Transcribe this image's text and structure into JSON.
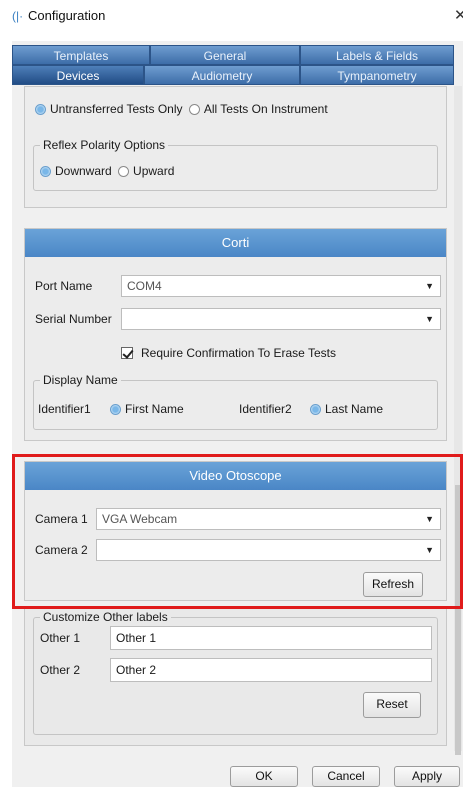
{
  "window": {
    "title": "Configuration",
    "close_glyph": "✕"
  },
  "tabs_row1": [
    {
      "label": "Templates"
    },
    {
      "label": "General"
    },
    {
      "label": "Labels & Fields"
    }
  ],
  "tabs_row2": [
    {
      "label": "Devices",
      "active": true
    },
    {
      "label": "Audiometry"
    },
    {
      "label": "Tympanometry"
    }
  ],
  "transfer": {
    "options": [
      {
        "label": "Untransferred Tests Only",
        "checked": true
      },
      {
        "label": "All Tests On Instrument",
        "checked": false
      }
    ]
  },
  "reflex": {
    "title": "Reflex Polarity Options",
    "options": [
      {
        "label": "Downward",
        "checked": true
      },
      {
        "label": "Upward",
        "checked": false
      }
    ]
  },
  "corti": {
    "header": "Corti",
    "port_label": "Port Name",
    "port_value": "COM4",
    "serial_label": "Serial Number",
    "serial_value": "",
    "confirm_label": "Require Confirmation To Erase Tests",
    "display_name_title": "Display Name",
    "identifier1_label": "Identifier1",
    "identifier1_value": "First Name",
    "identifier2_label": "Identifier2",
    "identifier2_value": "Last Name"
  },
  "otoscope": {
    "header": "Video Otoscope",
    "camera1_label": "Camera 1",
    "camera1_value": "VGA Webcam",
    "camera2_label": "Camera 2",
    "camera2_value": "",
    "refresh_label": "Refresh"
  },
  "other_labels": {
    "title": "Customize Other labels",
    "other1_label": "Other 1",
    "other1_value": "Other 1",
    "other2_label": "Other 2",
    "other2_value": "Other 2",
    "reset_label": "Reset"
  },
  "footer": {
    "ok": "OK",
    "cancel": "Cancel",
    "apply": "Apply"
  },
  "colors": {
    "highlight": "#e01b1b",
    "tab": "#3d6da8",
    "panel_header": "#5a95cf"
  },
  "icons": {
    "app": "config-app-icon",
    "caret": "chevron-down-icon"
  }
}
